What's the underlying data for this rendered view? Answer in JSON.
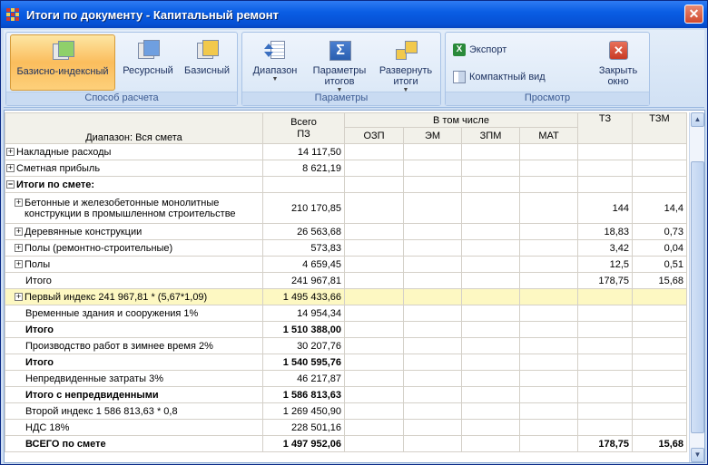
{
  "window": {
    "title": "Итоги по документу - Капитальный ремонт",
    "close_glyph": "✕"
  },
  "ribbon": {
    "groups": [
      {
        "label": "Способ расчета"
      },
      {
        "label": "Параметры"
      },
      {
        "label": "Просмотр"
      }
    ],
    "buttons": {
      "base_index": "Базисно-индексный",
      "resource": "Ресурсный",
      "base": "Базисный",
      "range": "Диапазон",
      "totals_params_1": "Параметры",
      "totals_params_2": "итогов",
      "expand_1": "Развернуть",
      "expand_2": "итоги",
      "export": "Экспорт",
      "compact": "Компактный вид",
      "close_1": "Закрыть",
      "close_2": "окно"
    },
    "active_button": "base_index",
    "icons": {
      "excel": "excel-icon",
      "close": "close-window-icon"
    }
  },
  "grid": {
    "header": {
      "range": "Диапазон: Вся смета",
      "total_1": "Всего",
      "total_2": "ПЗ",
      "incl": "В том числе",
      "ozp": "ОЗП",
      "em": "ЭМ",
      "zpm": "ЗПМ",
      "mat": "МАТ",
      "tz": "ТЗ",
      "tzm": "ТЗМ"
    },
    "rows": [
      {
        "name": "Накладные расходы",
        "total": "14 117,50",
        "tz": "",
        "tzm": "",
        "level": 0,
        "expander": "+",
        "bold": false
      },
      {
        "name": "Сметная прибыль",
        "total": "8 621,19",
        "tz": "",
        "tzm": "",
        "level": 0,
        "expander": "+",
        "bold": false
      },
      {
        "name": "Итоги по смете:",
        "total": "",
        "tz": "",
        "tzm": "",
        "level": 0,
        "expander": "−",
        "bold": true
      },
      {
        "name": "Бетонные и железобетонные монолитные конструкции в промышленном строительстве",
        "total": "210 170,85",
        "tz": "144",
        "tzm": "14,4",
        "level": 1,
        "expander": "+",
        "bold": false
      },
      {
        "name": "Деревянные конструкции",
        "total": "26 563,68",
        "tz": "18,83",
        "tzm": "0,73",
        "level": 1,
        "expander": "+",
        "bold": false
      },
      {
        "name": "Полы (ремонтно-строительные)",
        "total": "573,83",
        "tz": "3,42",
        "tzm": "0,04",
        "level": 1,
        "expander": "+",
        "bold": false
      },
      {
        "name": "Полы",
        "total": "4 659,45",
        "tz": "12,5",
        "tzm": "0,51",
        "level": 1,
        "expander": "+",
        "bold": false
      },
      {
        "name": "Итого",
        "total": "241 967,81",
        "tz": "178,75",
        "tzm": "15,68",
        "level": 2,
        "expander": "",
        "bold": false
      },
      {
        "name": "Первый индекс 241 967,81 * (5,67*1,09)",
        "total": "1 495 433,66",
        "tz": "",
        "tzm": "",
        "level": 1,
        "expander": "+",
        "bold": false,
        "selected": true
      },
      {
        "name": "Временные здания и сооружения 1%",
        "total": "14 954,34",
        "tz": "",
        "tzm": "",
        "level": 2,
        "expander": "",
        "bold": false
      },
      {
        "name": "Итого",
        "total": "1 510 388,00",
        "tz": "",
        "tzm": "",
        "level": 2,
        "expander": "",
        "bold": true
      },
      {
        "name": "Производство работ в зимнее время 2%",
        "total": "30 207,76",
        "tz": "",
        "tzm": "",
        "level": 2,
        "expander": "",
        "bold": false
      },
      {
        "name": "Итого",
        "total": "1 540 595,76",
        "tz": "",
        "tzm": "",
        "level": 2,
        "expander": "",
        "bold": true
      },
      {
        "name": "Непредвиденные затраты 3%",
        "total": "46 217,87",
        "tz": "",
        "tzm": "",
        "level": 2,
        "expander": "",
        "bold": false
      },
      {
        "name": "Итого с непредвиденными",
        "total": "1 586 813,63",
        "tz": "",
        "tzm": "",
        "level": 2,
        "expander": "",
        "bold": true
      },
      {
        "name": "Второй индекс 1 586 813,63 * 0,8",
        "total": "1 269 450,90",
        "tz": "",
        "tzm": "",
        "level": 2,
        "expander": "",
        "bold": false
      },
      {
        "name": "НДС 18%",
        "total": "228 501,16",
        "tz": "",
        "tzm": "",
        "level": 2,
        "expander": "",
        "bold": false
      },
      {
        "name": "ВСЕГО по смете",
        "total": "1 497 952,06",
        "tz": "178,75",
        "tzm": "15,68",
        "level": 2,
        "expander": "",
        "bold": true
      }
    ]
  },
  "scrollbar": {
    "up": "▲",
    "down": "▼"
  }
}
